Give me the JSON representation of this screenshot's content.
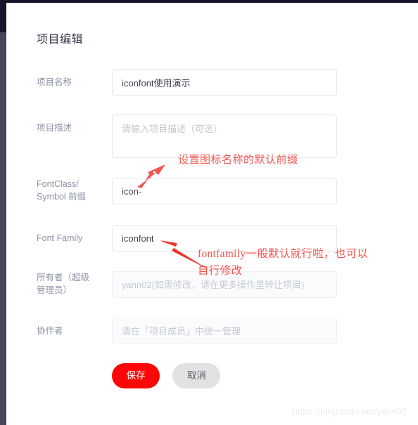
{
  "app": {
    "sidebar_color_top": "#17142b",
    "sidebar_color_bottom": "#4b4458",
    "accent_color": "#fb0707",
    "annotation_color": "#f4554f"
  },
  "page": {
    "title": "项目编辑"
  },
  "form": {
    "fields": [
      {
        "id": "project-name",
        "label": "项目名称",
        "value": "iconfont使用演示",
        "placeholder": "",
        "type": "input",
        "disabled": false
      },
      {
        "id": "project-description",
        "label": "项目描述",
        "value": "",
        "placeholder": "请输入项目描述（可选）",
        "type": "textarea",
        "disabled": false
      },
      {
        "id": "fontclass-prefix",
        "label": "FontClass/\nSymbol 前缀",
        "label_line1": "FontClass/",
        "label_line2": "Symbol 前缀",
        "value": "icon-",
        "placeholder": "",
        "type": "input",
        "disabled": false
      },
      {
        "id": "font-family",
        "label": "Font Family",
        "value": "iconfont",
        "placeholder": "",
        "type": "input",
        "disabled": false
      },
      {
        "id": "owner",
        "label_line1": "所有者（超级",
        "label_line2": "管理员）",
        "value": "",
        "placeholder": "yann02(如需修改，请在更多操作里转让项目)",
        "type": "input",
        "disabled": true
      },
      {
        "id": "collaborators",
        "label": "协作者",
        "value": "",
        "placeholder": "请在「项目成员」中统一管理",
        "type": "input",
        "disabled": true
      }
    ]
  },
  "buttons": {
    "save_label": "保存",
    "cancel_label": "取消"
  },
  "annotations": [
    {
      "id": "prefix-note",
      "text": "设置图标名称的默认前缀"
    },
    {
      "id": "fontfamily-note",
      "line1": "fontfamily一般默认就行啦，也可以",
      "line2": "自行修改"
    }
  ],
  "watermark": {
    "text": "https://blog.csdn.net/yann02"
  }
}
